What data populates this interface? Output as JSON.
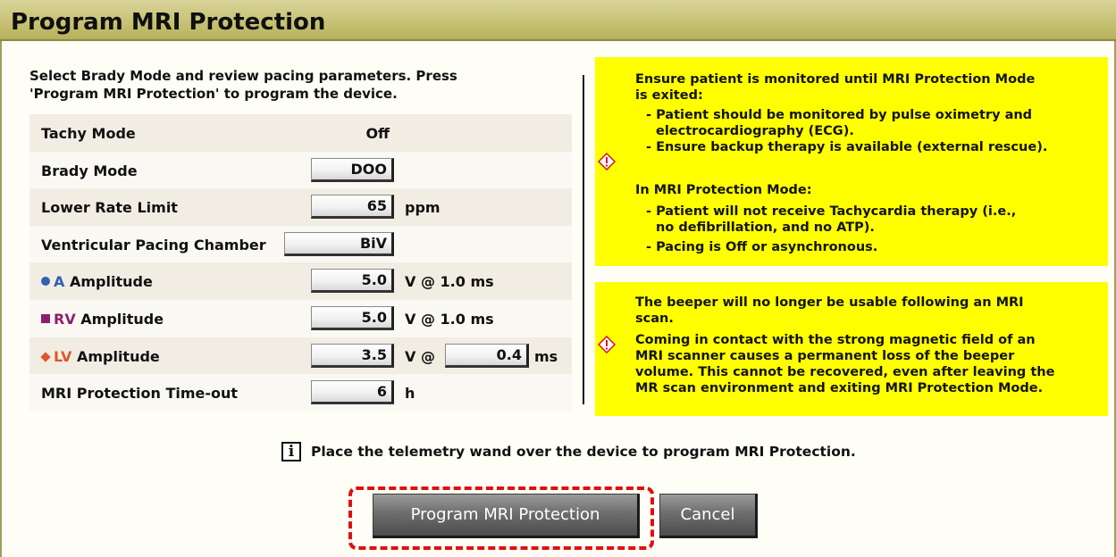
{
  "title": "Program MRI Protection",
  "intro": [
    "Select Brady Mode and review pacing parameters. Press",
    "'Program MRI Protection' to program the device."
  ],
  "params": {
    "tachy_mode": {
      "label": "Tachy Mode",
      "value": "Off"
    },
    "brady_mode": {
      "label": "Brady Mode",
      "value": "DOO"
    },
    "lower_rate": {
      "label": "Lower Rate Limit",
      "value": "65",
      "unit": "ppm"
    },
    "vent_chamber": {
      "label": "Ventricular Pacing Chamber",
      "value": "BiV"
    },
    "a_amp": {
      "prefix": "A",
      "label": "Amplitude",
      "value": "5.0",
      "unit": "V @ 1.0 ms"
    },
    "rv_amp": {
      "prefix": "RV",
      "label": "Amplitude",
      "value": "5.0",
      "unit": "V @ 1.0 ms"
    },
    "lv_amp": {
      "prefix": "LV",
      "label": "Amplitude",
      "value": "3.5",
      "unit": "V @",
      "pw_value": "0.4",
      "pw_unit": "ms"
    },
    "timeout": {
      "label": "MRI Protection Time-out",
      "value": "6",
      "unit": "h"
    }
  },
  "warning1": {
    "heading": [
      "Ensure patient is monitored until MRI Protection Mode",
      "is exited:"
    ],
    "b1": [
      "- Patient should be monitored by pulse oximetry and",
      "electrocardiography (ECG)."
    ],
    "b2": "- Ensure backup therapy is available (external rescue).",
    "subheading": "In MRI Protection Mode:",
    "b3": [
      "- Patient will not receive Tachycardia therapy (i.e.,",
      "no defibrillation, and no ATP)."
    ],
    "b4": "- Pacing is Off or asynchronous."
  },
  "warning2": {
    "lines": [
      "The beeper will no longer be usable following an MRI",
      "scan.",
      "Coming in contact with the strong magnetic field of an",
      "MRI scanner causes a permanent loss of the beeper",
      "volume. This cannot be recovered, even after leaving the",
      "MR scan environment and exiting MRI Protection Mode."
    ]
  },
  "info": {
    "icon_glyph": "i",
    "text": "Place the telemetry wand over the device to program MRI Protection."
  },
  "buttons": {
    "program": "Program MRI Protection",
    "cancel": "Cancel"
  },
  "icons": {
    "a_marker": "blue-circle-icon",
    "rv_marker": "purple-square-icon",
    "lv_marker": "orange-diamond-icon",
    "warning": "warning-diamond-icon",
    "info": "info-icon"
  },
  "colors": {
    "title_bar": "#c8c276",
    "warning_bg": "#ffff00",
    "highlight": "#dd1111",
    "a_color": "#3360b0",
    "rv_color": "#8c1f6f",
    "lv_color": "#e0552b",
    "button": "#6e6e6e"
  }
}
